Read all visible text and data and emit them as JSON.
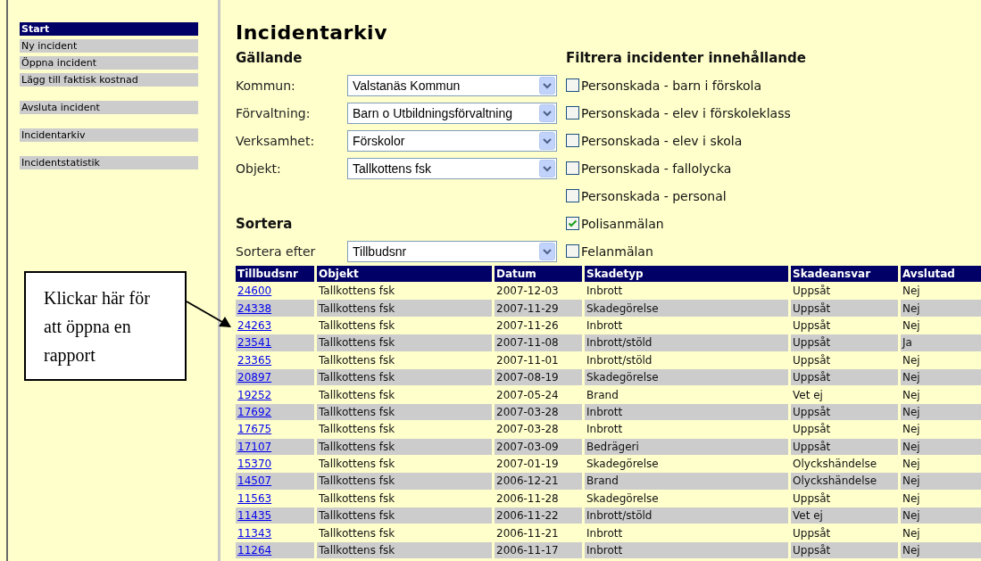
{
  "sidebar": {
    "groups": [
      [
        {
          "label": "Start",
          "selected": true
        },
        {
          "label": "Ny incident",
          "selected": false
        },
        {
          "label": "Öppna incident",
          "selected": false
        },
        {
          "label": "Lägg till faktisk kostnad",
          "selected": false
        }
      ],
      [
        {
          "label": "Avsluta incident",
          "selected": false
        }
      ],
      [
        {
          "label": "Incidentarkiv",
          "selected": false
        }
      ],
      [
        {
          "label": "Incidentstatistik",
          "selected": false
        }
      ]
    ]
  },
  "title": "Incidentarkiv",
  "current": {
    "heading": "Gällande",
    "fields": [
      {
        "label": "Kommun:",
        "value": "Valstanäs Kommun"
      },
      {
        "label": "Förvaltning:",
        "value": "Barn o Utbildningsförvaltning"
      },
      {
        "label": "Verksamhet:",
        "value": "Förskolor"
      },
      {
        "label": "Objekt:",
        "value": "Tallkottens fsk"
      }
    ]
  },
  "sort": {
    "heading": "Sortera",
    "label": "Sortera efter",
    "value": "Tillbudsnr"
  },
  "filter": {
    "heading": "Filtrera incidenter innehållande",
    "options": [
      {
        "label": "Personskada - barn i förskola",
        "checked": false
      },
      {
        "label": "Personskada - elev i förskoleklass",
        "checked": false
      },
      {
        "label": "Personskada - elev i skola",
        "checked": false
      },
      {
        "label": "Personskada - fallolycka",
        "checked": false
      },
      {
        "label": "Personskada - personal",
        "checked": false
      },
      {
        "label": "Polisanmälan",
        "checked": true
      },
      {
        "label": "Felanmälan",
        "checked": false
      }
    ]
  },
  "table": {
    "columns": [
      "Tillbudsnr",
      "Objekt",
      "Datum",
      "Skadetyp",
      "Skadeansvar",
      "Avslutad"
    ],
    "rows": [
      [
        "24600",
        "Tallkottens fsk",
        "2007-12-03",
        "Inbrott",
        "Uppsåt",
        "Nej"
      ],
      [
        "24338",
        "Tallkottens fsk",
        "2007-11-29",
        "Skadegörelse",
        "Uppsåt",
        "Nej"
      ],
      [
        "24263",
        "Tallkottens fsk",
        "2007-11-26",
        "Inbrott",
        "Uppsåt",
        "Nej"
      ],
      [
        "23541",
        "Tallkottens fsk",
        "2007-11-08",
        "Inbrott/stöld",
        "Uppsåt",
        "Ja"
      ],
      [
        "23365",
        "Tallkottens fsk",
        "2007-11-01",
        "Inbrott/stöld",
        "Uppsåt",
        "Nej"
      ],
      [
        "20897",
        "Tallkottens fsk",
        "2007-08-19",
        "Skadegörelse",
        "Uppsåt",
        "Nej"
      ],
      [
        "19252",
        "Tallkottens fsk",
        "2007-05-24",
        "Brand",
        "Vet ej",
        "Nej"
      ],
      [
        "17692",
        "Tallkottens fsk",
        "2007-03-28",
        "Inbrott",
        "Uppsåt",
        "Nej"
      ],
      [
        "17675",
        "Tallkottens fsk",
        "2007-03-28",
        "Inbrott",
        "Uppsåt",
        "Nej"
      ],
      [
        "17107",
        "Tallkottens fsk",
        "2007-03-09",
        "Bedrägeri",
        "Uppsåt",
        "Nej"
      ],
      [
        "15370",
        "Tallkottens fsk",
        "2007-01-19",
        "Skadegörelse",
        "Olyckshändelse",
        "Nej"
      ],
      [
        "14507",
        "Tallkottens fsk",
        "2006-12-21",
        "Brand",
        "Olyckshändelse",
        "Nej"
      ],
      [
        "11563",
        "Tallkottens fsk",
        "2006-11-28",
        "Skadegörelse",
        "Uppsåt",
        "Nej"
      ],
      [
        "11435",
        "Tallkottens fsk",
        "2006-11-22",
        "Inbrott/stöld",
        "Vet ej",
        "Nej"
      ],
      [
        "11343",
        "Tallkottens fsk",
        "2006-11-21",
        "Inbrott",
        "Uppsåt",
        "Nej"
      ],
      [
        "11264",
        "Tallkottens fsk",
        "2006-11-17",
        "Inbrott",
        "Uppsåt",
        "Nej"
      ]
    ]
  },
  "callout": {
    "text": "Klickar här för att öppna en rapport"
  }
}
